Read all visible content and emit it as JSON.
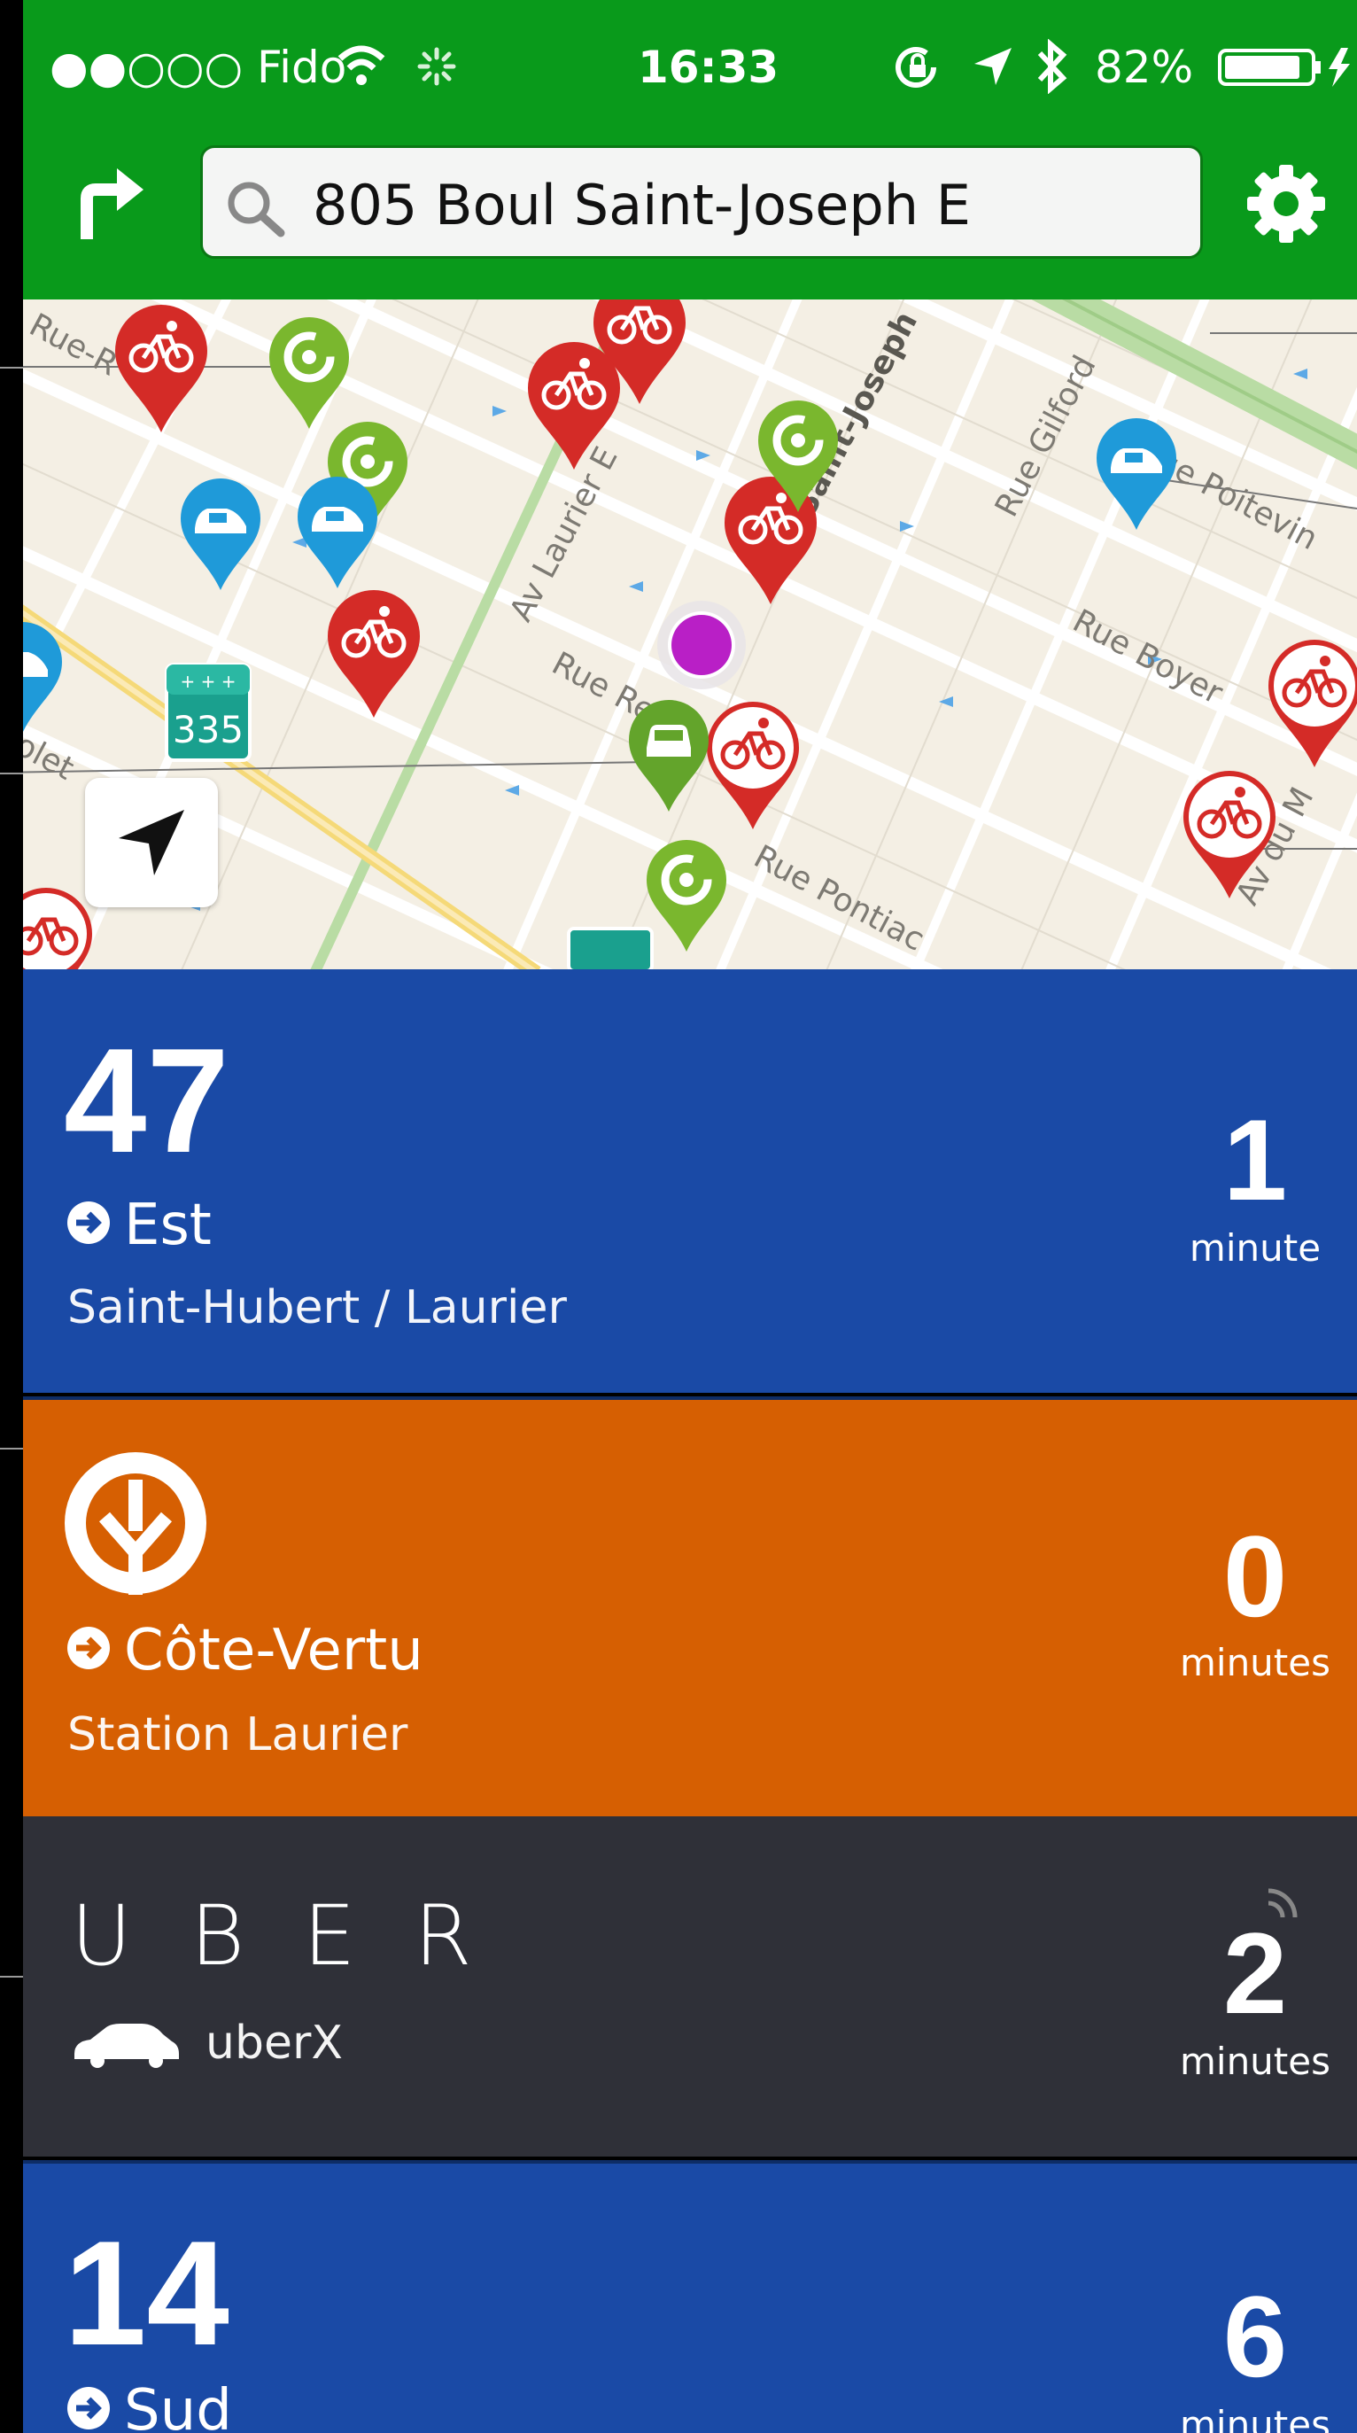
{
  "status_bar": {
    "carrier": "●●○○○ Fido",
    "time": "16:33",
    "battery": "82%"
  },
  "top_bar": {
    "search_value": "805 Boul Saint-Joseph E",
    "icons": [
      "directions-icon",
      "search-icon",
      "gear-icon"
    ]
  },
  "map": {
    "streets": {
      "rue_r": "Rue-R",
      "av_laurier": "Av Laurier E",
      "saint_joseph": "Saint-Joseph",
      "rue_gilford": "Rue Gilford",
      "rue_poitevin": "Rue Poitevin",
      "rue_boyer": "Rue Boyer",
      "rue_re": "Rue Re",
      "rue_pontiac": "Rue Pontiac",
      "av_du_m": "Av du M",
      "rue_pole": "olet",
      "highway": "335"
    }
  },
  "cards": [
    {
      "number": "47",
      "direction": "Est",
      "stop": "Saint-Hubert / Laurier",
      "eta": "1",
      "eta_unit": "minute",
      "color": "#1a4aa6"
    },
    {
      "direction": "Côte-Vertu",
      "stop": "Station Laurier",
      "eta": "0",
      "eta_unit": "minutes",
      "color": "#d65f02"
    },
    {
      "brand": "U B E R",
      "service": "uberX",
      "eta": "2",
      "eta_unit": "minutes",
      "color": "#2f3038"
    },
    {
      "number": "14",
      "direction": "Sud",
      "eta": "6",
      "eta_unit": "minutes",
      "color": "#1a4aa6"
    }
  ],
  "colors": {
    "bar_green": "#099a1b",
    "bixi_red": "#d42b27",
    "communauto_green": "#7ab72e",
    "car2go_blue": "#1f9ad9",
    "user_purple": "#b91fc6"
  }
}
